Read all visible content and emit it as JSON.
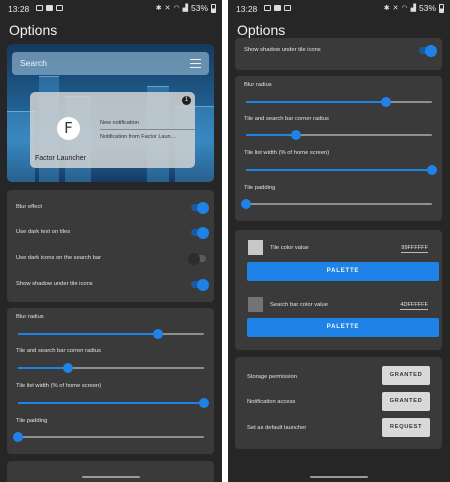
{
  "status_bar": {
    "time": "13:28",
    "battery": "53%"
  },
  "app": {
    "title": "Options"
  },
  "search": {
    "placeholder": "Search"
  },
  "notification": {
    "badge": "1",
    "logo_letter": "F",
    "title": "New notification",
    "message": "Notification from Factor Laun…",
    "app_name": "Factor Launcher"
  },
  "toggles": [
    {
      "label": "Blur effect",
      "on": true
    },
    {
      "label": "Use dark text on tiles",
      "on": true
    },
    {
      "label": "Use dark icons on the search bar",
      "on": false
    },
    {
      "label": "Show shadow under tile icons",
      "on": true
    }
  ],
  "sliders": [
    {
      "label": "Blur radius",
      "value_fraction": 0.75
    },
    {
      "label": "Tile and search bar corner radius",
      "value_fraction": 0.27
    },
    {
      "label": "Tile list width (% of home screen)",
      "value_fraction": 1.0
    },
    {
      "label": "Tile padding",
      "value_fraction": 0.0
    }
  ],
  "colors": [
    {
      "label": "Tile color value",
      "value": "99FFFFFF",
      "swatch": "#c8c8c8",
      "button": "PALETTE"
    },
    {
      "label": "Search bar color value",
      "value": "4DFFFFFF",
      "swatch": "#737373",
      "button": "PALETTE"
    }
  ],
  "permissions": [
    {
      "label": "Storage permission",
      "button": "GRANTED"
    },
    {
      "label": "Notification access",
      "button": "GRANTED"
    },
    {
      "label": "Set as default launcher",
      "button": "REQUEST"
    }
  ],
  "theme": {
    "accent": "#1e82e6",
    "background": "#262626",
    "card": "#3a3a3a"
  }
}
